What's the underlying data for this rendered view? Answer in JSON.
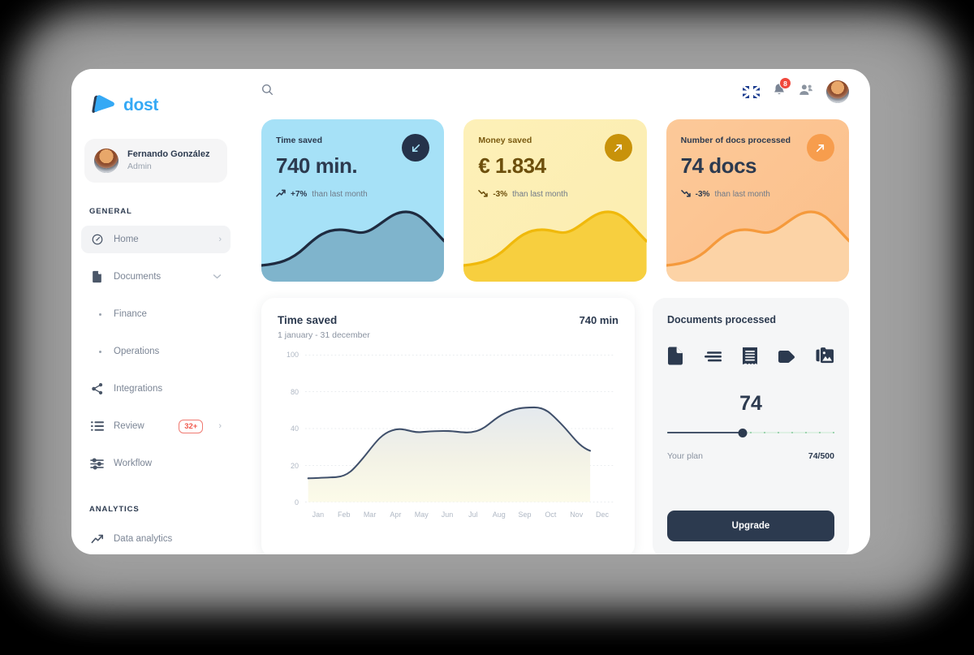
{
  "brand": {
    "name": "dost",
    "logo_icon": "play-triangle-icon",
    "accent": "#35a9f5"
  },
  "user": {
    "name": "Fernando González",
    "role": "Admin"
  },
  "topbar": {
    "search_icon": "search-icon",
    "language_icon": "uk-flag-icon",
    "notifications_icon": "bell-icon",
    "notifications_count": "8",
    "add_user_icon": "add-user-icon",
    "avatar_icon": "avatar"
  },
  "sidebar": {
    "sections": [
      {
        "title": "GENERAL"
      },
      {
        "title": "ANALYTICS"
      }
    ],
    "items": [
      {
        "label": "Home",
        "icon": "gauge-icon",
        "active": true,
        "chevron": "›"
      },
      {
        "label": "Documents",
        "icon": "document-icon",
        "chevron": "∨"
      },
      {
        "label": "Finance",
        "icon": "bullet-dot-icon"
      },
      {
        "label": "Operations",
        "icon": "bullet-dot-icon"
      },
      {
        "label": "Integrations",
        "icon": "share-icon"
      },
      {
        "label": "Review",
        "icon": "list-icon",
        "badge": "32+",
        "chevron": "›"
      },
      {
        "label": "Workflow",
        "icon": "sliders-icon"
      },
      {
        "label": "Data analytics",
        "icon": "trend-up-icon"
      }
    ]
  },
  "kpis": [
    {
      "label": "Time saved",
      "value": "740 min.",
      "delta": "+7%",
      "delta_suffix": "than last month",
      "trend_icon": "arrow-trend-up-icon",
      "badge_icon": "arrow-down-left-icon",
      "color": "#a6e1f7"
    },
    {
      "label": "Money saved",
      "value": "€ 1.834",
      "delta": "-3%",
      "delta_suffix": "than last month",
      "trend_icon": "arrow-trend-down-icon",
      "badge_icon": "arrow-up-right-icon",
      "color": "#fcedb0"
    },
    {
      "label": "Number of docs processed",
      "value": "74 docs",
      "delta": "-3%",
      "delta_suffix": "than last month",
      "trend_icon": "arrow-trend-down-icon",
      "badge_icon": "arrow-up-right-icon",
      "color": "#fbbf8a"
    }
  ],
  "chart_card": {
    "title": "Time saved",
    "subtitle": "1 january - 31 december",
    "total": "740 min"
  },
  "chart_data": {
    "type": "area",
    "title": "Time saved",
    "subtitle": "1 january - 31 december",
    "categories": [
      "Jan",
      "Feb",
      "Mar",
      "Apr",
      "May",
      "Jun",
      "Jul",
      "Aug",
      "Sep",
      "Oct",
      "Nov",
      "Dec"
    ],
    "values": [
      13,
      13.5,
      19,
      29,
      37,
      38,
      37.5,
      39,
      48,
      58,
      50,
      32
    ],
    "yticks": [
      0,
      20,
      40,
      80,
      100
    ],
    "ylim": [
      0,
      100
    ],
    "xlabel": "",
    "ylabel": "",
    "grid": true,
    "legend": "none",
    "line_color": "#40506b",
    "fill_top": "#e8ecef",
    "fill_bottom": "#fbf8e4"
  },
  "docs_card": {
    "title": "Documents processed",
    "doc_icons": [
      "file-icon",
      "text-lines-icon",
      "receipt-icon",
      "tag-icon",
      "images-icon"
    ],
    "count": "74",
    "plan_label": "Your plan",
    "plan_value": "74/500",
    "progress_percent": 45,
    "upgrade_label": "Upgrade"
  }
}
